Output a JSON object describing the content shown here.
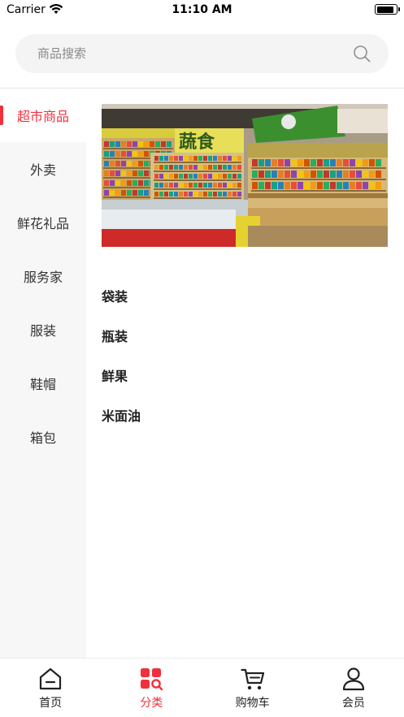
{
  "status_bar": {
    "carrier": "Carrier",
    "time": "11:10 AM",
    "battery_level": 0.95
  },
  "search": {
    "placeholder": "商品搜索",
    "value": ""
  },
  "sidebar": {
    "items": [
      {
        "label": "超市商品",
        "active": true
      },
      {
        "label": "外卖",
        "active": false
      },
      {
        "label": "鲜花礼品",
        "active": false
      },
      {
        "label": "服务家",
        "active": false
      },
      {
        "label": "服装",
        "active": false
      },
      {
        "label": "鞋帽",
        "active": false
      },
      {
        "label": "箱包",
        "active": false
      }
    ]
  },
  "banner": {
    "sign_text": "蔬食",
    "image": "supermarket-produce-shelf"
  },
  "categories": [
    "袋装",
    "瓶装",
    "鲜果",
    "米面油"
  ],
  "tabbar": {
    "items": [
      {
        "label": "首页",
        "icon": "home-icon",
        "active": false
      },
      {
        "label": "分类",
        "icon": "category-icon",
        "active": true
      },
      {
        "label": "购物车",
        "icon": "cart-icon",
        "active": false
      },
      {
        "label": "会员",
        "icon": "user-icon",
        "active": false
      }
    ]
  },
  "colors": {
    "accent": "#f0303c",
    "sidebar_bg": "#f7f7f7",
    "search_bg": "#f4f4f4"
  }
}
